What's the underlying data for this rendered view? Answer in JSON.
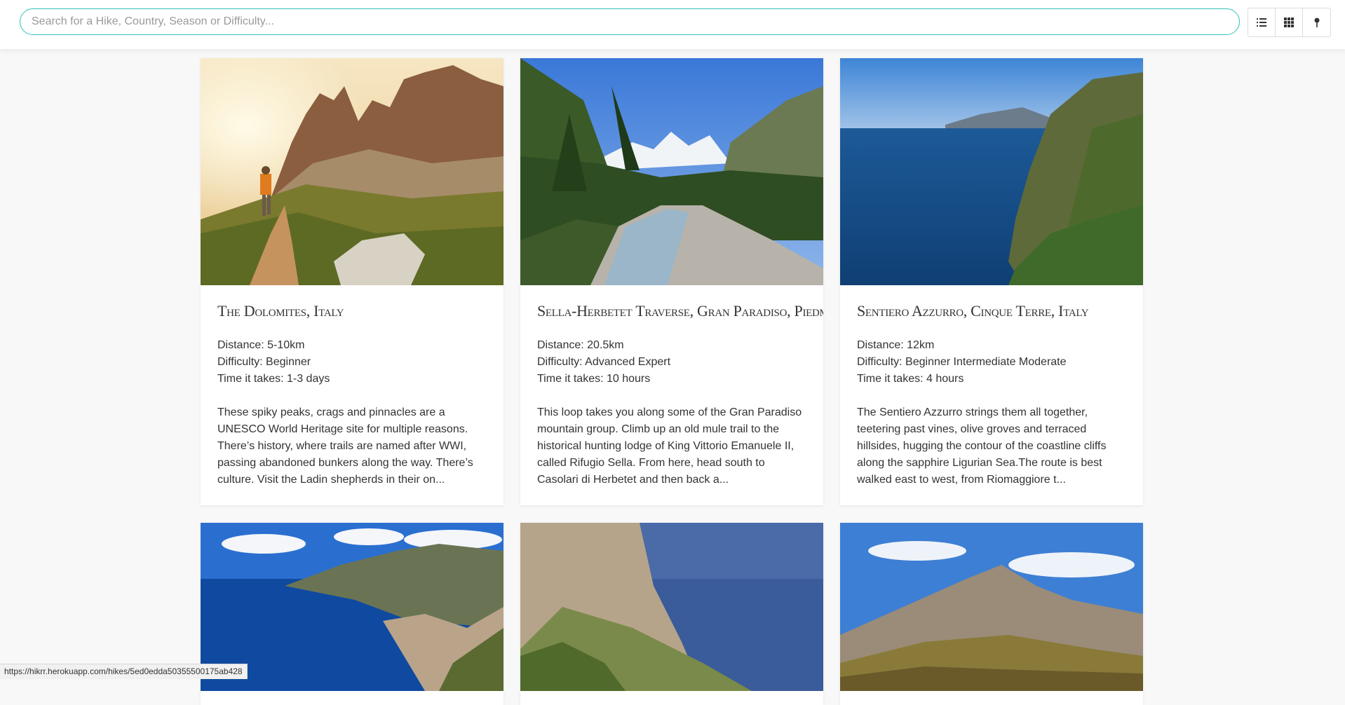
{
  "search": {
    "placeholder": "Search for a Hike, Country, Season or Difficulty..."
  },
  "view_toggle": [
    "list-view-icon",
    "grid-view-icon",
    "map-pin-icon"
  ],
  "hikes": [
    {
      "title": "The Dolomites, Italy",
      "distance": "Distance: 5-10km",
      "difficulty": "Difficulty: Beginner",
      "time": "Time it takes: 1-3 days",
      "description": "These spiky peaks, crags and pinnacles are a UNESCO World Heritage site for multiple reasons. There’s history, where trails are named after WWI, passing abandoned bunkers along the way. There’s culture. Visit the Ladin shepherds in their on..."
    },
    {
      "title": "Sella-Herbetet Traverse, Gran Paradiso, Piedmont, Italy",
      "distance": "Distance: 20.5km",
      "difficulty": "Difficulty: Advanced Expert",
      "time": "Time it takes: 10 hours",
      "description": "This loop takes you along some of the Gran Paradiso mountain group. Climb up an old mule trail to the historical hunting lodge of King Vittorio Emanuele II, called Rifugio Sella. From here, head south to Casolari di Herbetet and then back a..."
    },
    {
      "title": "Sentiero Azzurro, Cinque Terre, Italy",
      "distance": "Distance: 12km",
      "difficulty": "Difficulty: Beginner Intermediate Moderate",
      "time": "Time it takes: 4 hours",
      "description": "The Sentiero Azzurro strings them all together, teetering past vines, olive groves and terraced hillsides, hugging the contour of the coastline cliffs along the sapphire Ligurian Sea.The route is best walked east to west, from Riomaggiore t..."
    }
  ],
  "status_url": "https://hikrr.herokuapp.com/hikes/5ed0edda50355500175ab428",
  "colors": {
    "search_border": "#2ec4b6",
    "page_bg": "#f8f8f8"
  }
}
